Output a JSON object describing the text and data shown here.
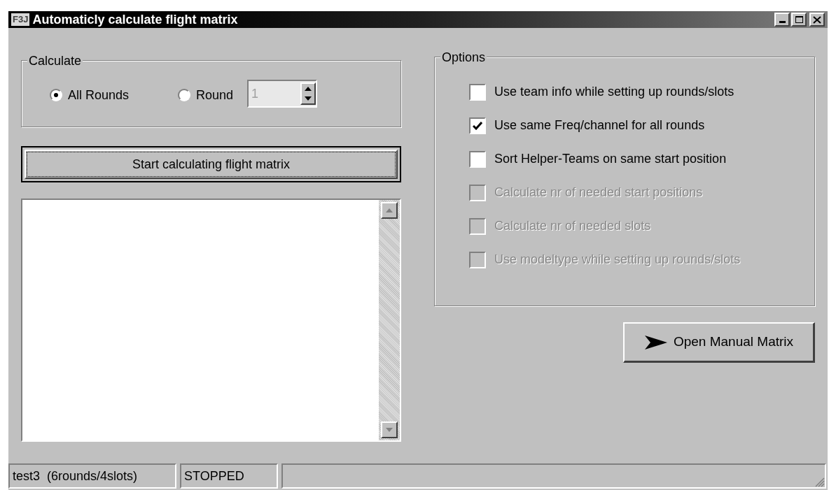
{
  "window": {
    "icon_text": "F3J",
    "title": "Automaticly calculate flight matrix"
  },
  "calculate": {
    "title": "Calculate",
    "radios": [
      {
        "label": "All Rounds",
        "selected": true
      },
      {
        "label": "Round",
        "selected": false
      }
    ],
    "round_spinner": {
      "value": "1",
      "disabled": true
    }
  },
  "start_button": {
    "label": "Start calculating flight matrix",
    "focused": true
  },
  "options": {
    "title": "Options",
    "items": [
      {
        "label": "Use team info while setting up rounds/slots",
        "checked": false,
        "disabled": false
      },
      {
        "label": "Use same Freq/channel for all rounds",
        "checked": true,
        "disabled": false
      },
      {
        "label": "Sort Helper-Teams on same start position",
        "checked": false,
        "disabled": false
      },
      {
        "label": "Calculate nr of needed start positions",
        "checked": false,
        "disabled": true
      },
      {
        "label": "Calculate nr of needed slots",
        "checked": false,
        "disabled": true
      },
      {
        "label": "Use modeltype while setting up rounds/slots",
        "checked": false,
        "disabled": true
      }
    ]
  },
  "open_button": {
    "label": "Open Manual Matrix"
  },
  "status_bar": [
    "test3  (6rounds/4slots)",
    "STOPPED"
  ]
}
